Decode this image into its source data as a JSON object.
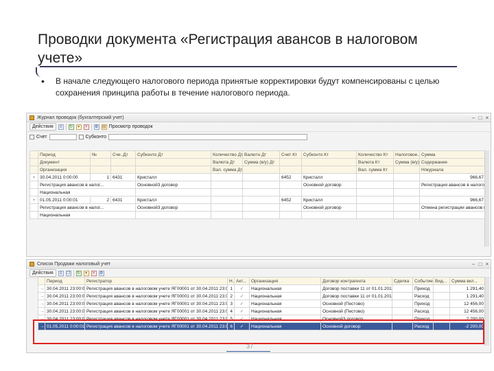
{
  "slide": {
    "title": "Проводки документа «Регистрация авансов в налоговом учете»",
    "bullet": "В начале следующего налогового периода принятые корректировки будут компенсированы с целью сохранения принципа работы  в течение налогового периода."
  },
  "journal": {
    "window_title": "Журнал проводок (бухгалтерский учет)",
    "actions_label": "Действия",
    "report_btn": "Просмотр проводок",
    "filter_label": "Счет",
    "filter2_label": "Субконто",
    "headers1": [
      "Период",
      "№",
      "Сче..Дт",
      "Субконто Дт",
      "Количество Дт",
      "Валютн Дт",
      "Счет Кт",
      "Субконто Кт",
      "Количество Кт",
      "Налоговое...",
      "Сумма"
    ],
    "headers2": [
      "Документ",
      "",
      "",
      "",
      "Валюта Дт",
      "Сумма (в/у) Дт",
      "",
      "",
      "Валюта Кт",
      "Сумма (в/у) Кт",
      "Содержание"
    ],
    "headers3": [
      "Организация",
      "",
      "",
      "",
      "Вал. сумма Дт",
      "",
      "",
      "",
      "Вал. сумма Кт",
      "",
      "Н/журнала"
    ],
    "rows": [
      {
        "date": "30.04.2011 0:00:00",
        "num": "1",
        "dt": "6431",
        "sub_dt": "Кристалл",
        "kt": "6452",
        "sub_kt": "Кристалл",
        "sum": "966,67",
        "doc": "Регистрация авансов в налог...",
        "sub_dt2": "Основной3 договор",
        "sub_kt2": "Основной договор",
        "content": "Регистрация авансов в налоговом ..",
        "org": "Национальная"
      },
      {
        "date": "01.05.2011 0:00:01",
        "num": "2",
        "dt": "6431",
        "sub_dt": "Кристалл",
        "kt": "6452",
        "sub_kt": "Кристалл",
        "sum": "966,67",
        "doc": "Регистрация авансов в налог...",
        "sub_dt2": "Основной3 договор",
        "sub_kt2": "Основной договор",
        "content": "Отмена регистрации авансов в нало..",
        "org": "Национальная"
      }
    ]
  },
  "sales": {
    "window_title": "Список Продажи налоговый учет",
    "actions_label": "Действия",
    "headers": [
      "Период",
      "Регистратор",
      "Н..",
      "Акт...",
      "Организация",
      "Договор контрагента",
      "Сделка",
      "Событие",
      "Вид...",
      "Сумма вкл..."
    ],
    "rows": [
      {
        "date": "30.04.2011 23:00:00",
        "reg": "Регистрация авансов в налоговом учете ЯГ00001 от 30.04.2011 23:00:00",
        "n": "1",
        "org": "Национальная",
        "contract": "Договор поставки 11 от 01.01.2011(1)",
        "deal": "",
        "event": "Приход",
        "type": "",
        "sum": "1 291,40"
      },
      {
        "date": "30.04.2011 23:00:00",
        "reg": "Регистрация авансов в налоговом учете ЯГ00001 от 30.04.2011 23:00:00",
        "n": "2",
        "org": "Национальная",
        "contract": "Договор поставки 11 от 01.01.2011(1)",
        "deal": "",
        "event": "Расход",
        "type": "",
        "sum": "1 291,40"
      },
      {
        "date": "30.04.2011 23:00:00",
        "reg": "Регистрация авансов в налоговом учете ЯГ00001 от 30.04.2011 23:00:00",
        "n": "3",
        "org": "Национальная",
        "contract": "Основной (Пестово)",
        "deal": "",
        "event": "Приход",
        "type": "",
        "sum": "12 456,00"
      },
      {
        "date": "30.04.2011 23:00:00",
        "reg": "Регистрация авансов в налоговом учете ЯГ00001 от 30.04.2011 23:00:00",
        "n": "4",
        "org": "Национальная",
        "contract": "Основной (Пестово)",
        "deal": "",
        "event": "Расход",
        "type": "",
        "sum": "12 456,00"
      },
      {
        "date": "30.04.2011 23:00:00",
        "reg": "Регистрация авансов в налоговом учете ЯГ00001 от 30.04.2011 23:00:00",
        "n": "5",
        "org": "Национальная",
        "contract": "Основной3 договор",
        "deal": "",
        "event": "Приход",
        "type": "",
        "sum": "2 200,00"
      },
      {
        "date": "01.05.2011 0:00:01",
        "reg": "Регистрация авансов в налоговом учете ЯГ00001 от 30.04.2011 23:00:00",
        "n": "6",
        "org": "Национальная",
        "contract": "Основной договор",
        "deal": "",
        "event": "Расход",
        "type": "",
        "sum": "-2 200,00"
      }
    ]
  },
  "page_number": "37",
  "colors": {
    "highlight": "#e02020",
    "header_bg": "#fbf6e3",
    "accent": "#3a5a9a"
  }
}
